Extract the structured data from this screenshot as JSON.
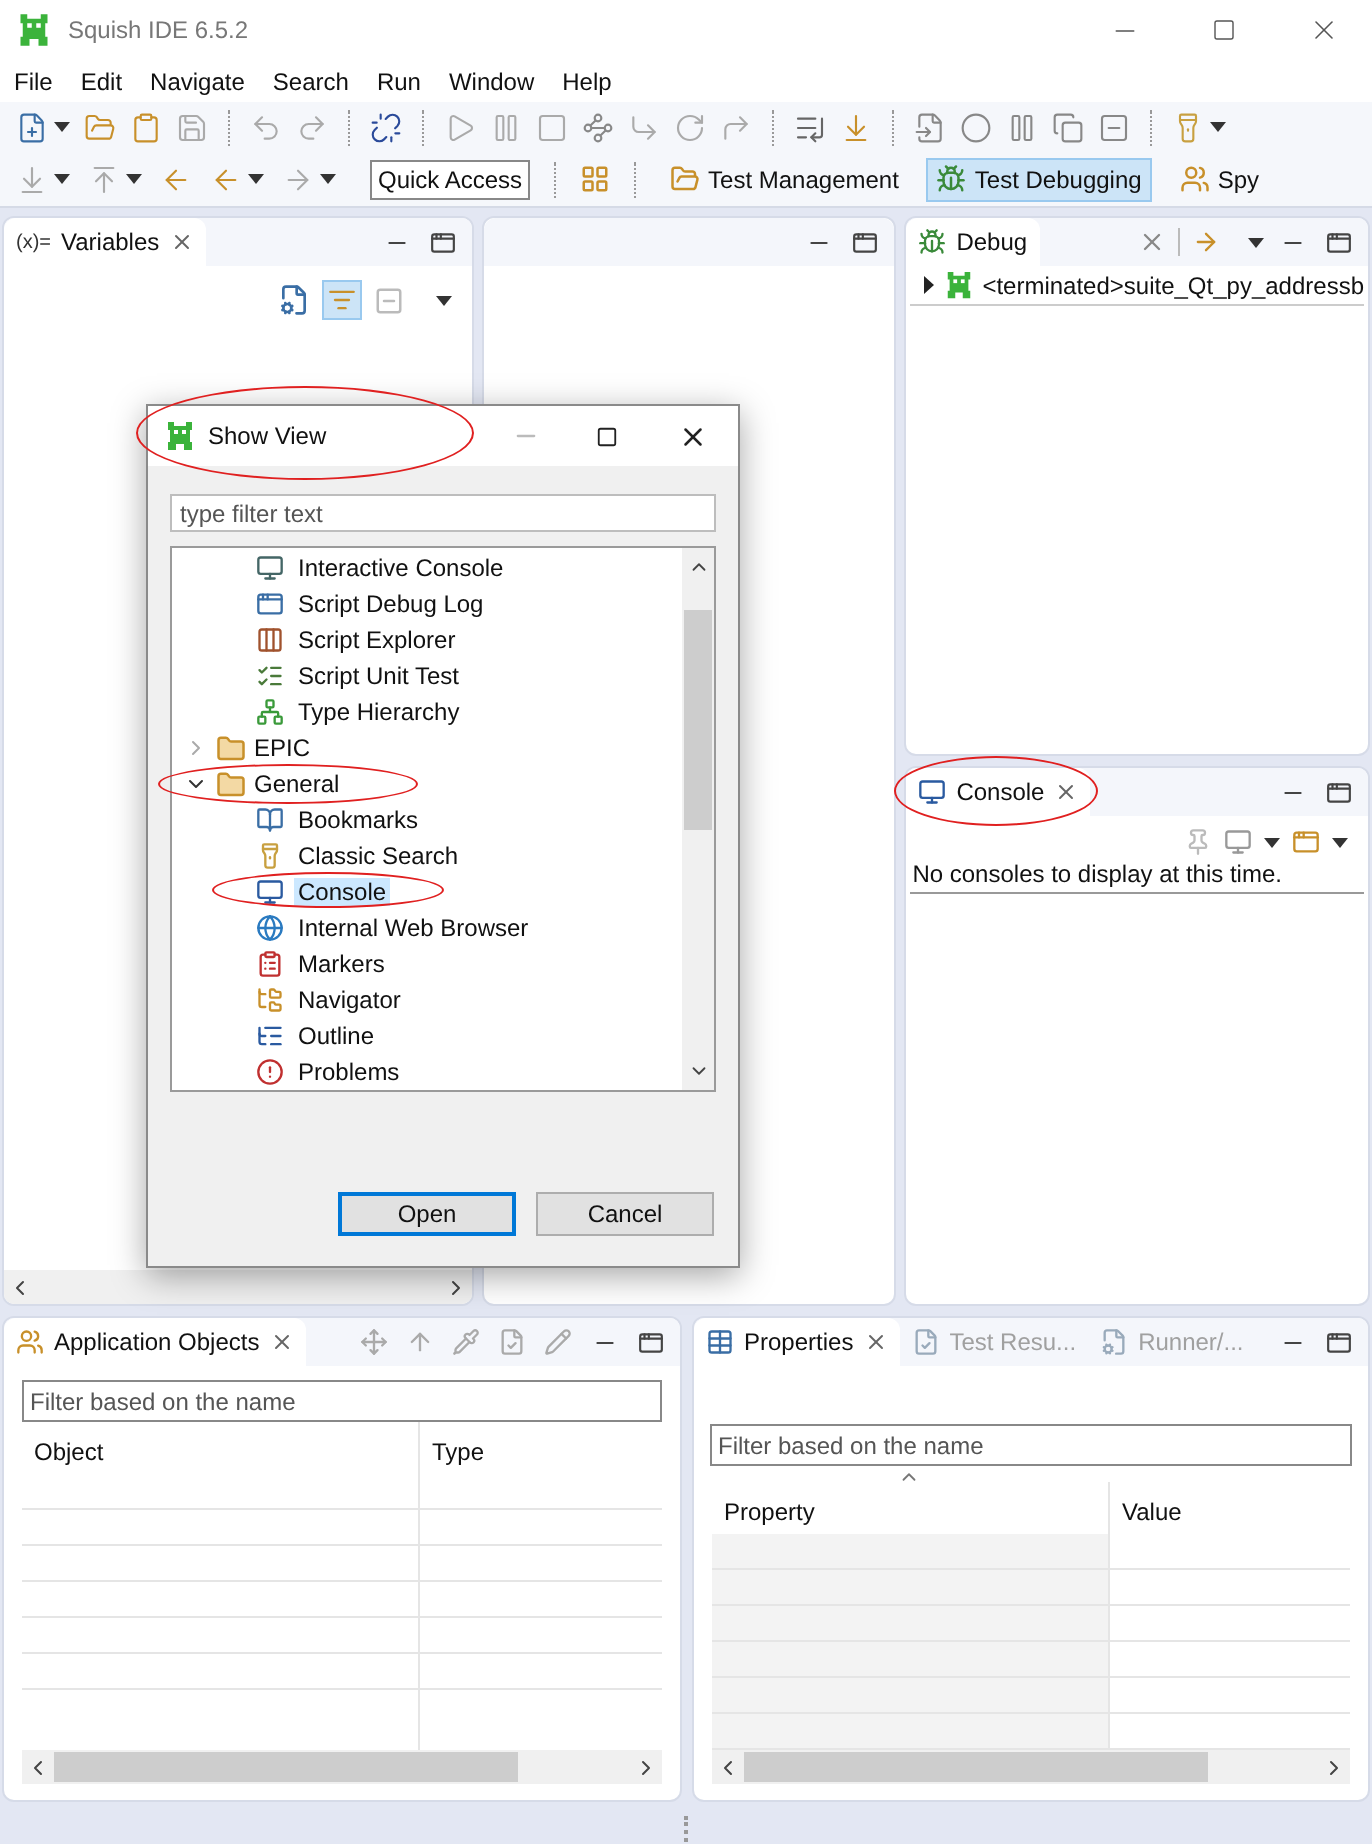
{
  "window": {
    "title": "Squish IDE 6.5.2"
  },
  "menu": [
    "File",
    "Edit",
    "Navigate",
    "Search",
    "Run",
    "Window",
    "Help"
  ],
  "toolbar": {
    "quick_access": "Quick Access",
    "perspectives": [
      {
        "label": "Test Management",
        "selected": false
      },
      {
        "label": "Test Debugging",
        "selected": true
      },
      {
        "label": "Spy",
        "selected": false
      }
    ]
  },
  "variables_view": {
    "icon_text": "(x)=",
    "tab": "Variables"
  },
  "debug_view": {
    "tab": "Debug",
    "items": [
      {
        "label": "<terminated>suite_Qt_py_addressb",
        "expanded": false
      }
    ]
  },
  "console_view": {
    "tab": "Console",
    "message": "No consoles to display at this time."
  },
  "app_objects_view": {
    "tab": "Application Objects",
    "filter": {
      "placeholder": "Filter based on the name"
    },
    "columns": [
      "Object",
      "Type"
    ]
  },
  "properties_view": {
    "tabs": [
      {
        "label": "Properties",
        "selected": true
      },
      {
        "label": "Test Resu...",
        "selected": false
      },
      {
        "label": "Runner/...",
        "selected": false
      }
    ],
    "filter": {
      "placeholder": "Filter based on the name"
    },
    "columns": [
      "Property",
      "Value"
    ]
  },
  "dialog": {
    "title": "Show View",
    "filter": {
      "placeholder": "type filter text"
    },
    "tree": [
      {
        "kind": "continued",
        "children": [
          {
            "label": "Interactive Console",
            "selected": false
          },
          {
            "label": "Script Debug Log",
            "selected": false
          },
          {
            "label": "Script Explorer",
            "selected": false
          },
          {
            "label": "Script Unit Test",
            "selected": false
          },
          {
            "label": "Type Hierarchy",
            "selected": false
          }
        ]
      },
      {
        "kind": "folder",
        "label": "EPIC",
        "expanded": false
      },
      {
        "kind": "folder",
        "label": "General",
        "expanded": true,
        "children": [
          {
            "label": "Bookmarks",
            "selected": false
          },
          {
            "label": "Classic Search",
            "selected": false
          },
          {
            "label": "Console",
            "selected": true
          },
          {
            "label": "Internal Web Browser",
            "selected": false
          },
          {
            "label": "Markers",
            "selected": false
          },
          {
            "label": "Navigator",
            "selected": false
          },
          {
            "label": "Outline",
            "selected": false
          },
          {
            "label": "Problems",
            "selected": false
          }
        ]
      }
    ],
    "buttons": [
      {
        "label": "Open",
        "default": true
      },
      {
        "label": "Cancel",
        "default": false
      }
    ]
  }
}
